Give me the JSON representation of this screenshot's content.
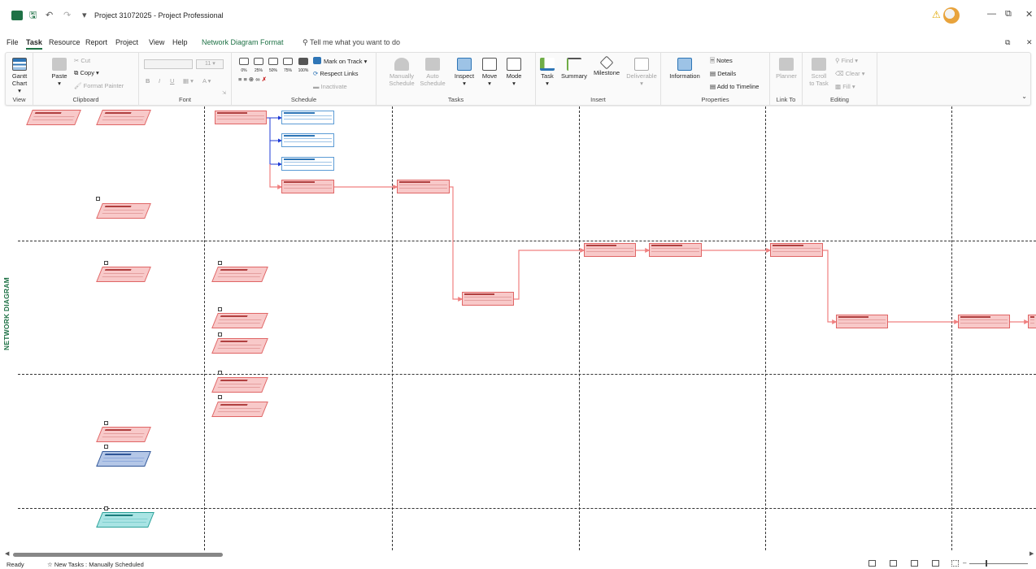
{
  "titlebar": {
    "doc_title": "Project 31072025 - Project Professional",
    "icons": [
      "app-icon",
      "save-icon",
      "undo-icon",
      "redo-icon",
      "warning-icon",
      "avatar",
      "minimize-icon",
      "restore-icon",
      "close-icon"
    ]
  },
  "menu": {
    "tabs": [
      "File",
      "Task",
      "Resource",
      "Report",
      "Project",
      "View",
      "Help",
      "Network Diagram Format"
    ],
    "active_tab": "Task",
    "tell_me": "Tell me what you want to do"
  },
  "ribbon": {
    "view": {
      "label": "View",
      "gantt": "Gantt",
      "chart": "Chart"
    },
    "clipboard": {
      "label": "Clipboard",
      "paste": "Paste",
      "cut": "Cut",
      "copy": "Copy",
      "format_painter": "Format Painter"
    },
    "font": {
      "label": "Font",
      "size": "11",
      "bold": "B",
      "italic": "I",
      "underline": "U"
    },
    "schedule": {
      "label": "Schedule",
      "percents": [
        "0%",
        "25%",
        "50%",
        "75%",
        "100%"
      ],
      "mark_on_track": "Mark on Track",
      "respect_links": "Respect Links",
      "inactivate": "Inactivate"
    },
    "tasks": {
      "label": "Tasks",
      "manually": "Manually",
      "manually2": "Schedule",
      "auto": "Auto",
      "auto2": "Schedule",
      "inspect": "Inspect",
      "move": "Move",
      "mode": "Mode"
    },
    "insert": {
      "label": "Insert",
      "task": "Task",
      "summary": "Summary",
      "milestone": "Milestone",
      "deliverable": "Deliverable"
    },
    "properties": {
      "label": "Properties",
      "information": "Information",
      "notes": "Notes",
      "details": "Details",
      "add_to_timeline": "Add to Timeline"
    },
    "link_to": {
      "label": "Link To",
      "planner": "Planner"
    },
    "editing": {
      "label": "Editing",
      "scroll": "Scroll",
      "to_task": "to Task",
      "find": "Find",
      "clear": "Clear",
      "fill": "Fill"
    }
  },
  "diagram": {
    "view_label": "NETWORK DIAGRAM"
  },
  "status": {
    "ready": "Ready",
    "new_tasks": "New Tasks : Manually Scheduled"
  },
  "colors": {
    "accent": "#1e7145",
    "critical_node_fill": "#f8c9c9",
    "critical_node_border": "#e06666",
    "noncritical_border": "#5b9bd5",
    "link_critical": "#f08080",
    "link_noncritical": "#1f3bd6"
  }
}
